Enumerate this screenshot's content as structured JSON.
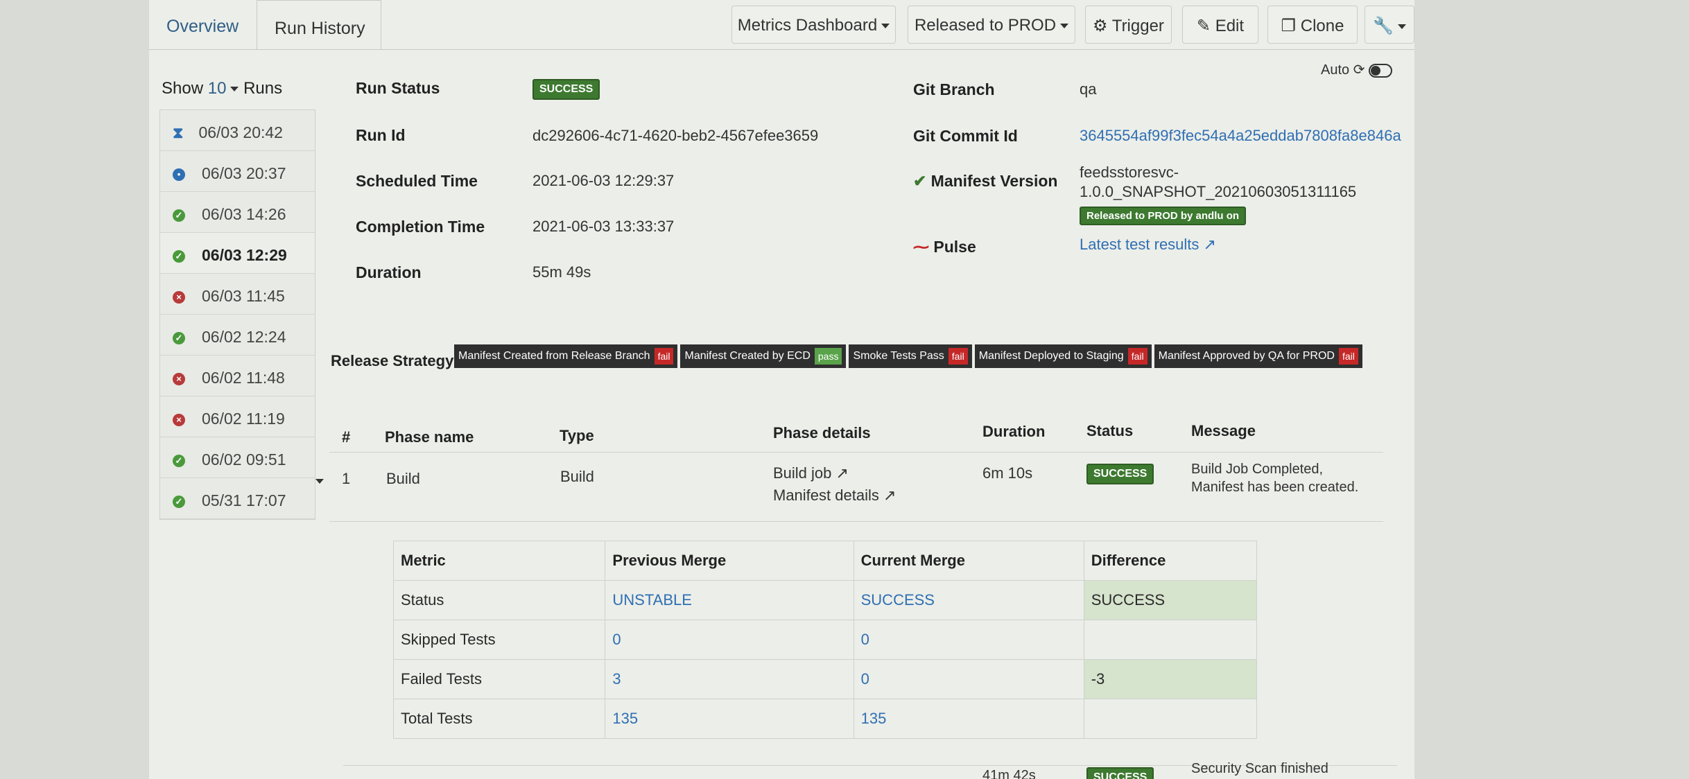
{
  "tabs": {
    "overview": "Overview",
    "run_history": "Run History"
  },
  "toolbar": {
    "metrics_dashboard": "Metrics Dashboard",
    "released_to_prod": "Released to PROD",
    "trigger": "Trigger",
    "edit": "Edit",
    "clone": "Clone"
  },
  "auto_label": "Auto",
  "sidebar": {
    "show_label": "Show",
    "show_count": "10",
    "runs_label": "Runs",
    "runs": [
      {
        "time": "06/03 20:42",
        "status": "running"
      },
      {
        "time": "06/03 20:37",
        "status": "queued"
      },
      {
        "time": "06/03 14:26",
        "status": "success"
      },
      {
        "time": "06/03 12:29",
        "status": "success",
        "active": true
      },
      {
        "time": "06/03 11:45",
        "status": "failed"
      },
      {
        "time": "06/02 12:24",
        "status": "success"
      },
      {
        "time": "06/02 11:48",
        "status": "failed"
      },
      {
        "time": "06/02 11:19",
        "status": "failed"
      },
      {
        "time": "06/02 09:51",
        "status": "success"
      },
      {
        "time": "05/31 17:07",
        "status": "success"
      }
    ]
  },
  "details": {
    "run_status_label": "Run Status",
    "run_status": "SUCCESS",
    "run_id_label": "Run Id",
    "run_id": "dc292606-4c71-4620-beb2-4567efee3659",
    "scheduled_label": "Scheduled Time",
    "scheduled": "2021-06-03 12:29:37",
    "completion_label": "Completion Time",
    "completion": "2021-06-03 13:33:37",
    "duration_label": "Duration",
    "duration": "55m 49s",
    "git_branch_label": "Git Branch",
    "git_branch": "qa",
    "git_commit_label": "Git Commit Id",
    "git_commit": "3645554af99f3fec54a4a25eddab7808fa8e846a",
    "manifest_label": "Manifest Version",
    "manifest_line1": "feedsstoresvc-",
    "manifest_line2": "1.0.0_SNAPSHOT_20210603051311165",
    "released_badge": "Released to PROD by andlu on",
    "pulse_label": "Pulse",
    "pulse_link": "Latest test results"
  },
  "release_strategy": {
    "label": "Release Strategy",
    "steps": [
      {
        "name": "Manifest Created from Release Branch",
        "result": "fail"
      },
      {
        "name": "Manifest Created by ECD",
        "result": "pass"
      },
      {
        "name": "Smoke Tests Pass",
        "result": "fail"
      },
      {
        "name": "Manifest Deployed to Staging",
        "result": "fail"
      },
      {
        "name": "Manifest Approved by QA for PROD",
        "result": "fail"
      }
    ]
  },
  "phases": {
    "headers": {
      "num": "#",
      "name": "Phase name",
      "type": "Type",
      "details": "Phase details",
      "duration": "Duration",
      "status": "Status",
      "message": "Message"
    },
    "row1": {
      "num": "1",
      "name": "Build",
      "type": "Build",
      "link1": "Build job",
      "link2": "Manifest details",
      "duration": "6m 10s",
      "status": "SUCCESS",
      "message1": "Build Job Completed,",
      "message2": "Manifest has been created."
    },
    "row2": {
      "duration": "41m 42s",
      "status": "SUCCESS",
      "message": "Security Scan finished"
    }
  },
  "metrics": {
    "headers": [
      "Metric",
      "Previous Merge",
      "Current Merge",
      "Difference"
    ],
    "rows": [
      [
        "Status",
        "UNSTABLE",
        "SUCCESS",
        "SUCCESS"
      ],
      [
        "Skipped Tests",
        "0",
        "0",
        ""
      ],
      [
        "Failed Tests",
        "3",
        "0",
        "-3"
      ],
      [
        "Total Tests",
        "135",
        "135",
        ""
      ]
    ]
  },
  "colors": {
    "success": "#3d7a30",
    "fail": "#c62828",
    "link": "#2f6fb3"
  }
}
